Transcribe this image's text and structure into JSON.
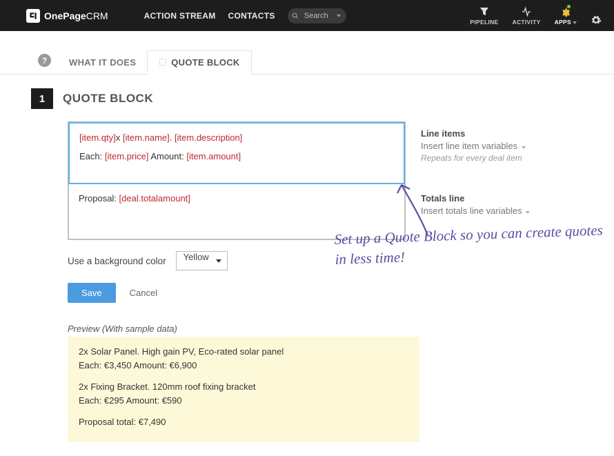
{
  "logo": {
    "main": "OnePage",
    "suffix": "CRM"
  },
  "nav": {
    "action_stream": "ACTION STREAM",
    "contacts": "CONTACTS",
    "search": "Search"
  },
  "right": {
    "pipeline": "PIPELINE",
    "activity": "ACTIVITY",
    "apps": "APPS"
  },
  "tabs": {
    "what": "WHAT IT DOES",
    "quote": "QUOTE BLOCK"
  },
  "step": {
    "num": "1",
    "title": "QUOTE BLOCK"
  },
  "editor": {
    "line1_a": "[item.qty]",
    "line1_b": "x ",
    "line1_c": "[item.name]",
    "line1_d": ". ",
    "line1_e": "[item.description]",
    "line2_a": "Each: ",
    "line2_b": "[item.price]",
    "line2_c": "  Amount: ",
    "line2_d": "[item.amount]",
    "totals_a": "Proposal: ",
    "totals_b": "[deal.totalamount]"
  },
  "side": {
    "line_items": "Line items",
    "insert_line": "Insert line item variables",
    "repeats": "Repeats for every deal item",
    "totals": "Totals line",
    "insert_totals": "Insert totals line variables"
  },
  "bg": {
    "label": "Use a background color",
    "value": "Yellow"
  },
  "buttons": {
    "save": "Save",
    "cancel": "Cancel"
  },
  "preview": {
    "label": "Preview (With sample data)",
    "l1": "2x Solar Panel. High gain PV, Eco-rated solar panel",
    "l2": "Each: €3,450  Amount: €6,900",
    "l3": "2x Fixing Bracket. 120mm roof fixing bracket",
    "l4": "Each: €295  Amount: €590",
    "l5": "Proposal total: €7,490"
  },
  "handwriting": "Set up a Quote Block so you can create quotes in less time!"
}
